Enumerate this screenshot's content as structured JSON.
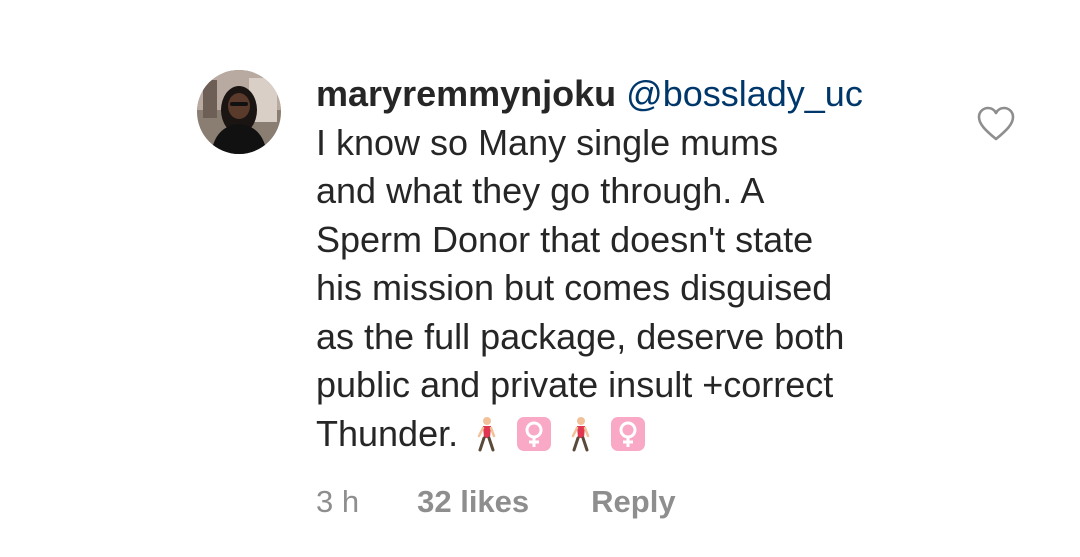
{
  "comment": {
    "avatar_icon": "user-profile-photo",
    "username": "maryremmynjoku",
    "mention": "@bosslady_uc",
    "text_lines": [
      "I know so Many single mums",
      "and what they go through. A",
      "Sperm Donor that doesn't state",
      "his mission but comes disguised",
      "as the full package, deserve both",
      "public and private insult +correct"
    ],
    "last_line": "Thunder.",
    "emojis": [
      "🚶‍♀️",
      "♀️",
      "🚶‍♀️",
      "♀️"
    ],
    "time": "3 h",
    "likes": "32 likes",
    "reply_label": "Reply",
    "like_icon": "heart-outline-icon"
  },
  "colors": {
    "text": "#262626",
    "mention": "#00376b",
    "meta": "#8e8e8e",
    "female_sign_bg": "#f9a8c6",
    "walker_shirt": "#e0364f"
  }
}
